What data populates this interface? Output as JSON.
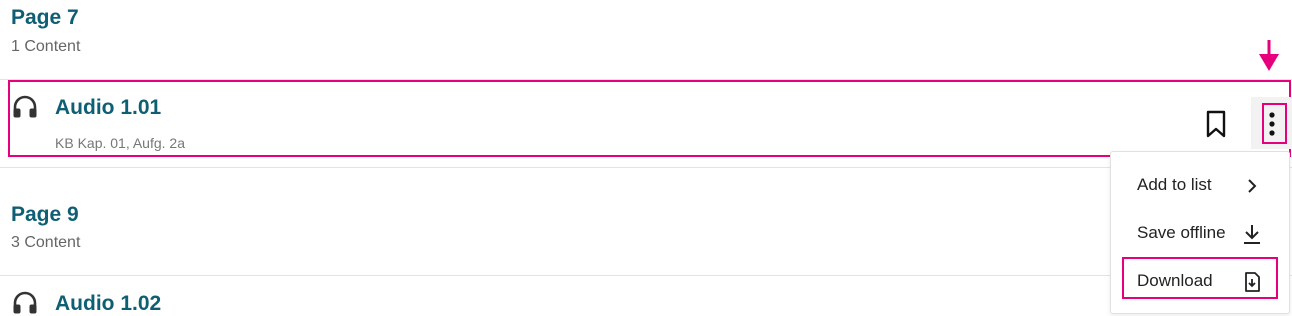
{
  "sections": [
    {
      "page_title": "Page 7",
      "content_count": "1 Content"
    },
    {
      "page_title": "Page 9",
      "content_count": "3 Content"
    }
  ],
  "items": [
    {
      "title": "Audio 1.01",
      "subtitle": "KB Kap. 01, Aufg. 2a"
    },
    {
      "title": "Audio 1.02"
    }
  ],
  "menu": {
    "items": [
      {
        "label": "Add to list",
        "icon": "chevron-right-icon"
      },
      {
        "label": "Save offline",
        "icon": "download-arrow-icon"
      },
      {
        "label": "Download",
        "icon": "file-download-icon"
      }
    ]
  },
  "colors": {
    "title": "#0e5f73",
    "highlight": "#e6007e",
    "muted_text": "#666666"
  }
}
